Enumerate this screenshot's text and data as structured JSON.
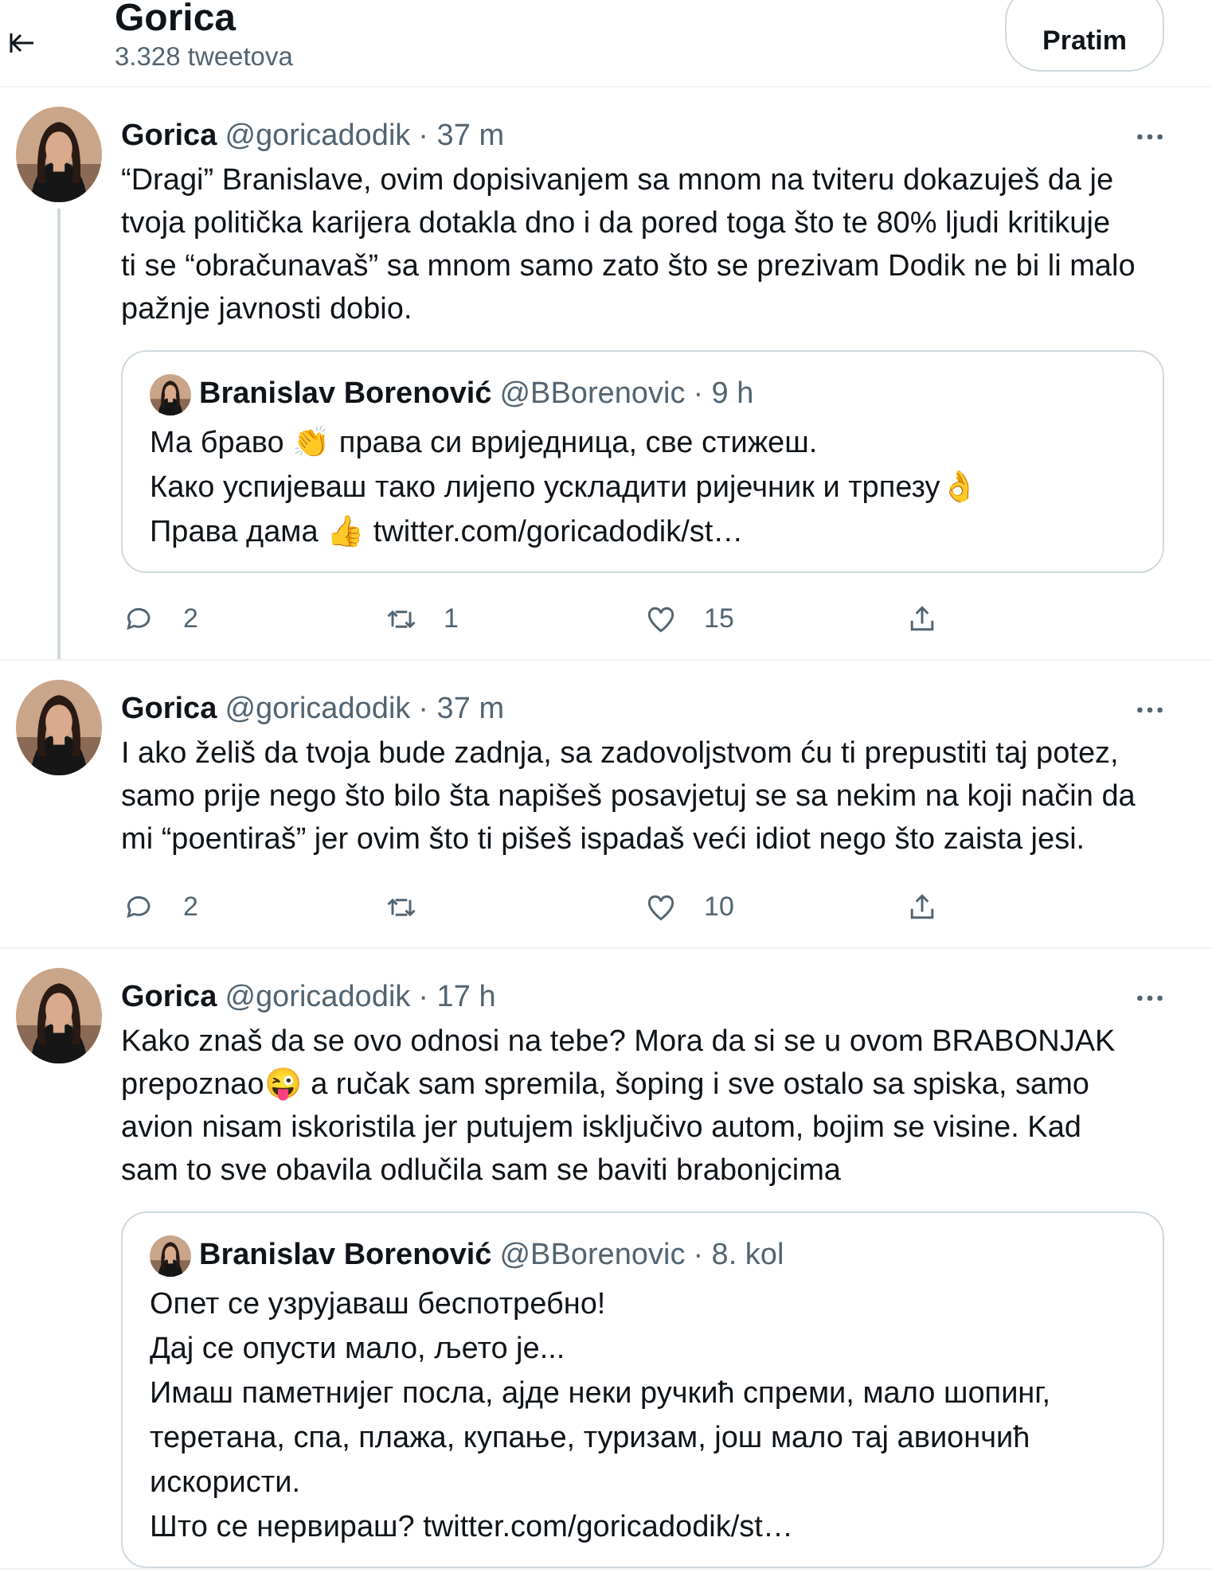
{
  "header": {
    "title": "Gorica",
    "subtitle": "3.328 tweetova",
    "follow_button": "Pratim"
  },
  "tweets": [
    {
      "name": "Gorica",
      "handle": "@goricadodik",
      "time": "· 37 m",
      "thread_continues": true,
      "text": "“Dragi” Branislave, ovim dopisivanjem sa mnom na tviteru dokazuješ da je\ntvoja politička karijera dotakla dno i da pored toga što te 80% ljudi kritikuje\nti se “obračunavaš” sa mnom samo zato što se prezivam Dodik ne bi li malo\npažnje javnosti dobio.",
      "quote": {
        "name": "Branislav Borenović",
        "handle": "@BBorenovic",
        "time": "· 9 h",
        "text": "Ма браво 👏 права си вриједница, све стижеш.\nКако успијеваш тако лијепо ускладити ријечник и трпезу👌\nПрава дама 👍 twitter.com/goricadodik/st…"
      },
      "actions": {
        "replies": "2",
        "retweets": "1",
        "likes": "15"
      }
    },
    {
      "name": "Gorica",
      "handle": "@goricadodik",
      "time": "· 37 m",
      "thread_continues": false,
      "text": "I ako želiš da tvoja bude zadnja, sa zadovoljstvom ću ti prepustiti taj potez,\nsamo prije nego što bilo šta napišeš posavjetuj se sa nekim na koji način da\nmi “poentiraš” jer ovim što ti pišeš ispadaš veći idiot nego što zaista jesi.",
      "actions": {
        "replies": "2",
        "likes": "10"
      }
    },
    {
      "name": "Gorica",
      "handle": "@goricadodik",
      "time": "· 17 h",
      "thread_continues": false,
      "text": "Kako znaš da se ovo odnosi na tebe? Mora da si se u ovom BRABONJAK\nprepoznao😜 a ručak sam spremila, šoping i sve ostalo sa spiska, samo\navion nisam iskoristila jer putujem isključivo autom, bojim se visine. Kad\nsam to sve obavila odlučila sam se baviti brabonjcima",
      "quote": {
        "name": "Branislav Borenović",
        "handle": "@BBorenovic",
        "time": "· 8. kol",
        "text": "Опет се узрујаваш беспотребно!\nДај се опусти мало, љето је...\nИмаш паметнијег посла, ајде неки ручкић спреми, мало шопинг,\nтеретана, спа, плажа, купање, туризам, још мало тај авиончић\nискористи.\nШто се нервираш? twitter.com/goricadodik/st…"
      }
    }
  ]
}
